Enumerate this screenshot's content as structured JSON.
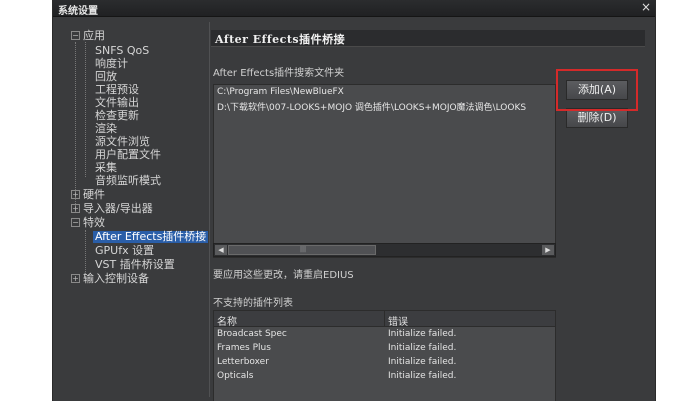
{
  "window": {
    "title": "系统设置",
    "close_glyph": "×"
  },
  "tree": {
    "app": "应用",
    "app_children": [
      "SNFS QoS",
      "响度计",
      "回放",
      "工程预设",
      "文件输出",
      "检查更新",
      "渲染",
      "源文件浏览",
      "用户配置文件",
      "采集",
      "音频监听模式"
    ],
    "hardware": "硬件",
    "importer": "导入器/导出器",
    "effects": "特效",
    "effects_children": [
      "After Effects插件桥接",
      "GPUfx 设置",
      "VST 插件桥设置"
    ],
    "input_control": "输入控制设备",
    "collapse_glyph": "−",
    "expand_glyph": "+"
  },
  "panel": {
    "header": "After Effects插件桥接",
    "search_label": "After Effects插件搜索文件夹",
    "paths": [
      "C:\\Program Files\\NewBlueFX",
      "D:\\下载软件\\007-LOOKS+MOJO 调色插件\\LOOKS+MOJO魔法调色\\LOOKS"
    ],
    "add_button": "添加(A)",
    "delete_button": "删除(D)",
    "restart_note": "要应用这些更改，请重启EDIUS",
    "unsupported_label": "不支持的插件列表",
    "scroll_left": "◀",
    "scroll_right": "▶",
    "scroll_grip": "|||"
  },
  "unsupported_table": {
    "columns": [
      "名称",
      "错误"
    ],
    "rows": [
      [
        "Broadcast Spec",
        "Initialize failed."
      ],
      [
        "Frames Plus",
        "Initialize failed."
      ],
      [
        "Letterboxer",
        "Initialize failed."
      ],
      [
        "Opticals",
        "Initialize failed."
      ]
    ]
  },
  "colors": {
    "selection": "#2a5ea8",
    "highlight_box": "#d42a2a"
  }
}
